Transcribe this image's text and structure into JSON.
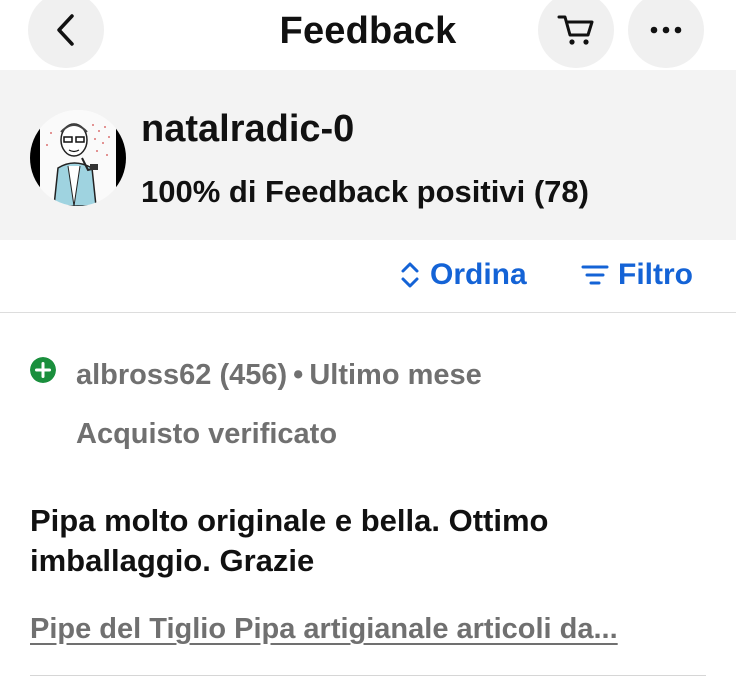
{
  "header": {
    "title": "Feedback",
    "back_icon": "chevron-left-icon",
    "cart_icon": "cart-icon",
    "more_icon": "more-horizontal-icon"
  },
  "profile": {
    "username": "natalradic-0",
    "rating": "100% di Feedback positivi (78)"
  },
  "toolbar": {
    "sort_label": "Ordina",
    "filter_label": "Filtro",
    "accent_color": "#1463d6"
  },
  "feedback": [
    {
      "status_icon": "plus-circle-icon",
      "status_color": "#1a8f3d",
      "user": "albross62 (456)",
      "separator": "•",
      "time": "Ultimo mese",
      "verified": "Acquisto verificato",
      "comment": "Pipa molto originale e bella. Ottimo imballaggio. Grazie",
      "item": "Pipe del Tiglio Pipa artigianale articoli da..."
    }
  ]
}
